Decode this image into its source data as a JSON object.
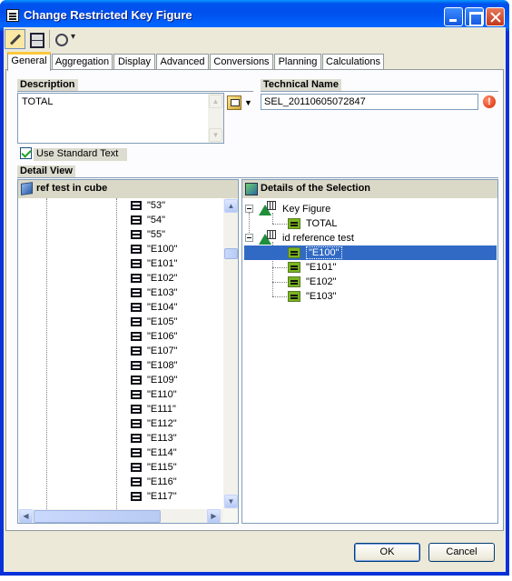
{
  "window": {
    "title": "Change Restricted Key Figure"
  },
  "tabs": [
    "General",
    "Aggregation",
    "Display",
    "Advanced",
    "Conversions",
    "Planning",
    "Calculations"
  ],
  "description": {
    "label": "Description",
    "value": "TOTAL"
  },
  "technical_name": {
    "label": "Technical Name",
    "value": "SEL_20110605072847"
  },
  "use_standard_text": {
    "label": "Use Standard Text",
    "checked": true
  },
  "detail_view": {
    "label": "Detail View",
    "left_pane": {
      "title": "ref test in cube",
      "items": [
        "\"53\"",
        "\"54\"",
        "\"55\"",
        "\"E100\"",
        "\"E101\"",
        "\"E102\"",
        "\"E103\"",
        "\"E104\"",
        "\"E105\"",
        "\"E106\"",
        "\"E107\"",
        "\"E108\"",
        "\"E109\"",
        "\"E110\"",
        "\"E111\"",
        "\"E112\"",
        "\"E113\"",
        "\"E114\"",
        "\"E115\"",
        "\"E116\"",
        "\"E117\""
      ]
    },
    "right_pane": {
      "title": "Details of the Selection",
      "key_figure": {
        "label": "Key Figure",
        "child": "TOTAL"
      },
      "characteristic": {
        "label": "id reference test",
        "children": [
          "\"E100\"",
          "\"E101\"",
          "\"E102\"",
          "\"E103\""
        ],
        "selected": "\"E100\""
      }
    }
  },
  "buttons": {
    "ok": "OK",
    "cancel": "Cancel"
  },
  "colors": {
    "titlebar": "#0054e3",
    "selection": "#316ac5",
    "window_bg": "#ece9d8"
  }
}
